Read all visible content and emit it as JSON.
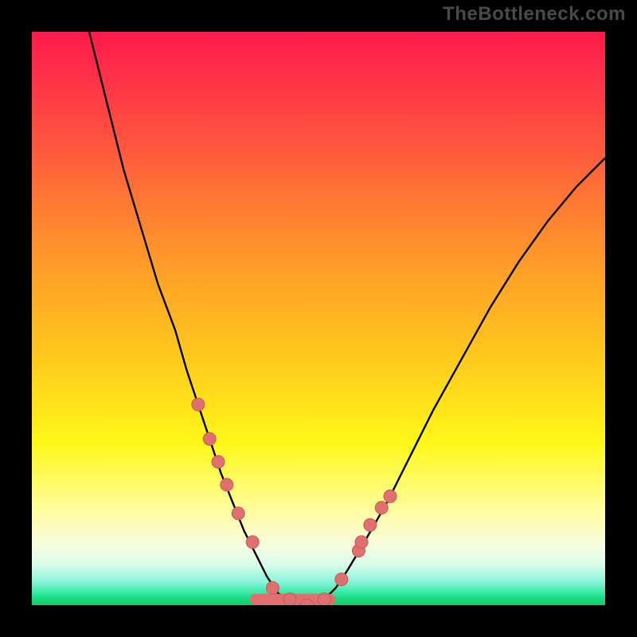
{
  "watermark": "TheBottleneck.com",
  "colors": {
    "frame": "#000000",
    "curve": "#000000",
    "marker_fill": "#e07070",
    "marker_stroke": "#c85a5a",
    "gradient_top": "#ff1a4a",
    "gradient_bottom": "#0fcf66"
  },
  "chart_data": {
    "type": "line",
    "title": "",
    "xlabel": "",
    "ylabel": "",
    "xlim": [
      0,
      100
    ],
    "ylim": [
      0,
      100
    ],
    "description": "V-shaped bottleneck curve over a vertical rainbow gradient; minimum near x≈42 at y≈0. Background color encodes bottleneck severity (top=red=high, bottom=green=low).",
    "series": [
      {
        "name": "bottleneck-curve",
        "x": [
          10,
          13,
          16,
          19,
          22,
          25,
          27,
          29,
          31,
          33,
          35,
          37,
          39,
          41,
          43,
          45,
          47,
          49,
          51,
          53,
          55,
          58,
          62,
          66,
          70,
          75,
          80,
          85,
          90,
          95,
          100
        ],
        "y": [
          100,
          88,
          76,
          66,
          56,
          48,
          41,
          35,
          29,
          23,
          18,
          13,
          9,
          5,
          2,
          1,
          0,
          0,
          1,
          3,
          6,
          11,
          18,
          26,
          34,
          43,
          52,
          60,
          67,
          73,
          78
        ]
      }
    ],
    "markers": {
      "name": "highlighted-points",
      "x": [
        29,
        31,
        32.5,
        34,
        36,
        38.5,
        42,
        45,
        48,
        51,
        54,
        57,
        57.5,
        59,
        61,
        62.5
      ],
      "y": [
        35,
        29,
        25,
        21,
        16,
        11,
        3,
        1,
        0,
        1,
        4.5,
        9.5,
        11,
        14,
        17,
        19
      ]
    },
    "floor_segment": {
      "x_start": 39,
      "x_end": 52,
      "y": 1
    }
  }
}
